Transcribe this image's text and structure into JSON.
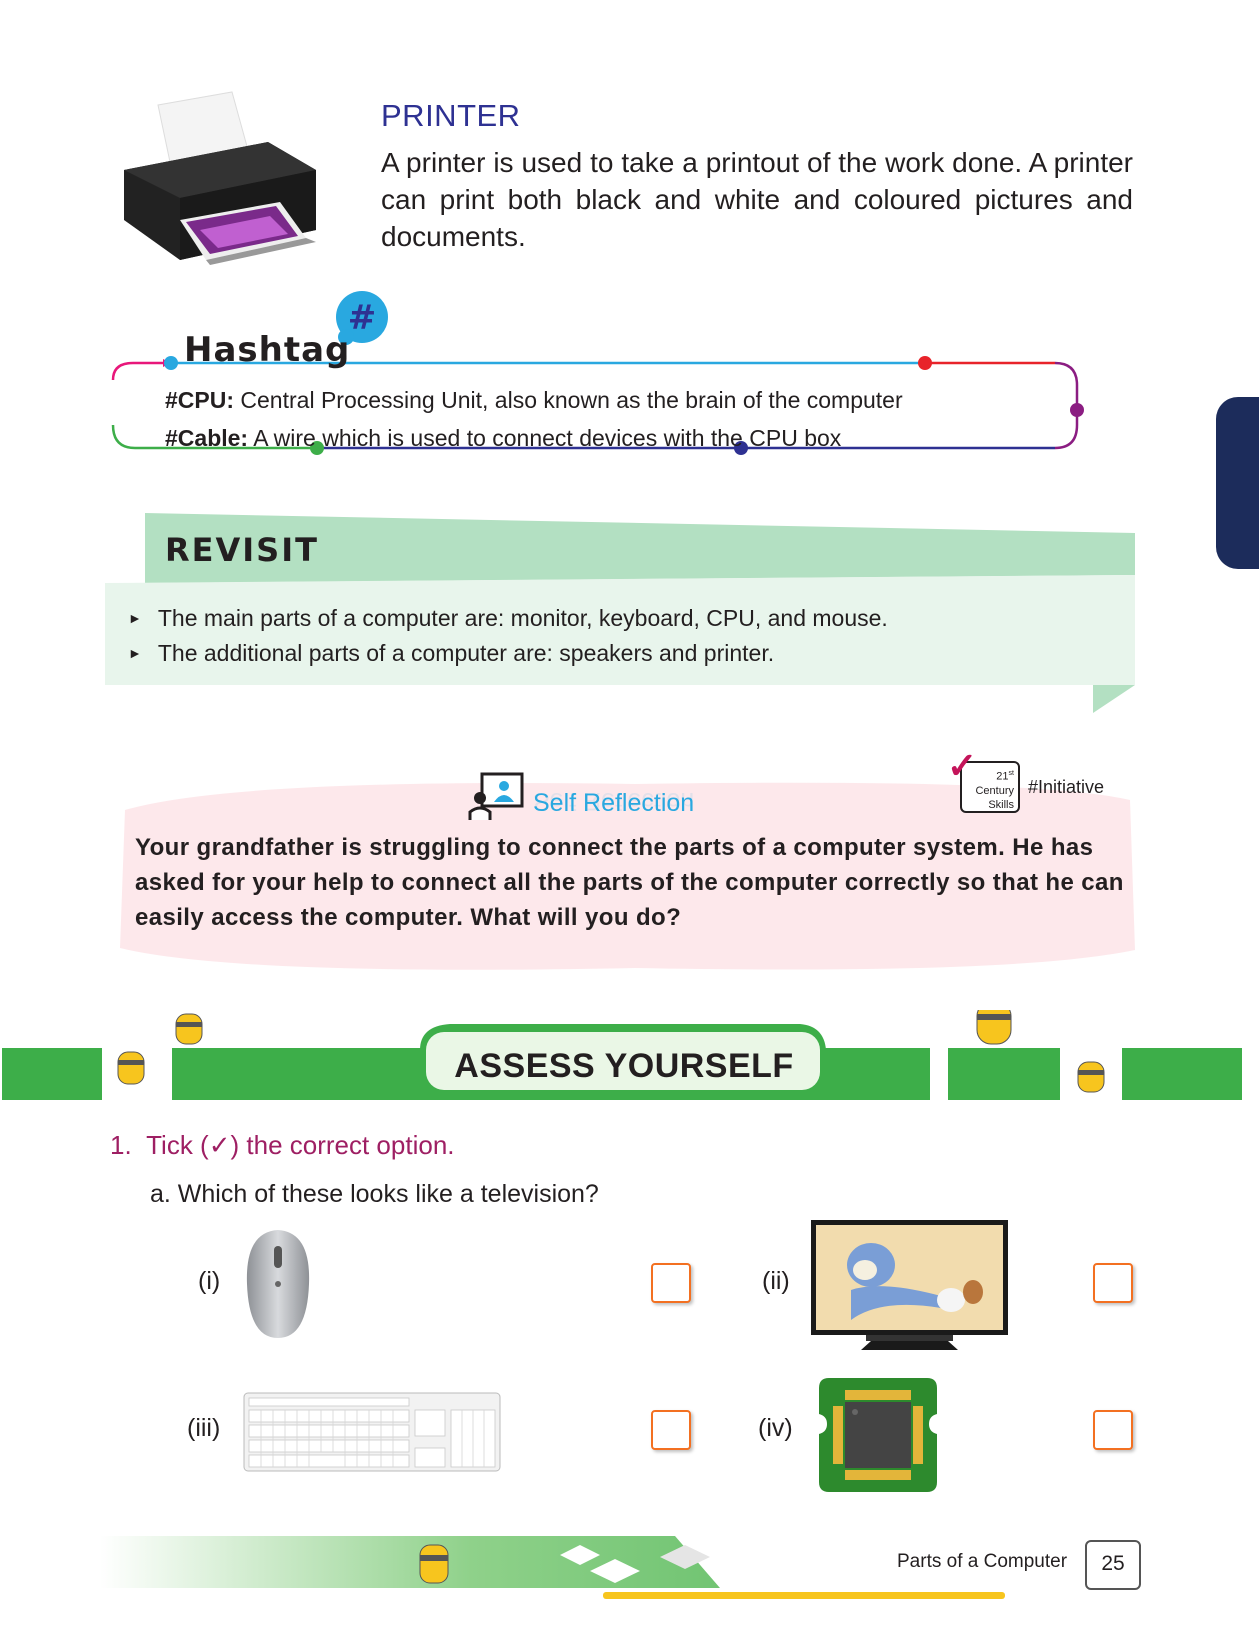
{
  "printer": {
    "title": "PRINTER",
    "text": "A printer is used to take a printout of the work done. A printer can print both black and white and coloured pictures and documents."
  },
  "hashtag": {
    "label": "Hashtag",
    "items": [
      {
        "term": "#CPU:",
        "definition": " Central Processing Unit, also known as the brain of the computer"
      },
      {
        "term": "#Cable:",
        "definition": " A wire which is used to connect devices with the CPU box"
      }
    ]
  },
  "revisit": {
    "title": "REVISIT",
    "items": [
      "The main parts of a computer are: monitor, keyboard, CPU, and mouse.",
      "The additional parts of a computer are: speakers and printer."
    ]
  },
  "self_reflection": {
    "title": "Self Reflection",
    "skills_badge": {
      "line1": "21",
      "sup": "st",
      "line2": "Century",
      "line3": "Skills"
    },
    "tag": "#Initiative",
    "text": "Your grandfather is struggling to connect the parts of a computer system. He has asked for your help to connect all the parts of the computer correctly so that he can easily access the computer. What will you do?"
  },
  "assess": {
    "title": "ASSESS YOURSELF"
  },
  "question1": {
    "number": "1.",
    "instruction": "Tick (✓) the correct option.",
    "sub_a": "a.  Which of these looks like a television?",
    "options": [
      {
        "label": "(i)",
        "icon": "mouse-image"
      },
      {
        "label": "(ii)",
        "icon": "television-image"
      },
      {
        "label": "(iii)",
        "icon": "keyboard-image"
      },
      {
        "label": "(iv)",
        "icon": "chip-image"
      }
    ]
  },
  "footer": {
    "chapter": "Parts of a Computer",
    "page": "25"
  },
  "colors": {
    "title_blue": "#2e3192",
    "question_magenta": "#9e1f63",
    "reflection_blue": "#29a8e0",
    "green": "#3dae49",
    "revisit_green": "#b3e0c2",
    "checkbox_orange": "#f37021",
    "side_tab": "#1c2c5b"
  }
}
